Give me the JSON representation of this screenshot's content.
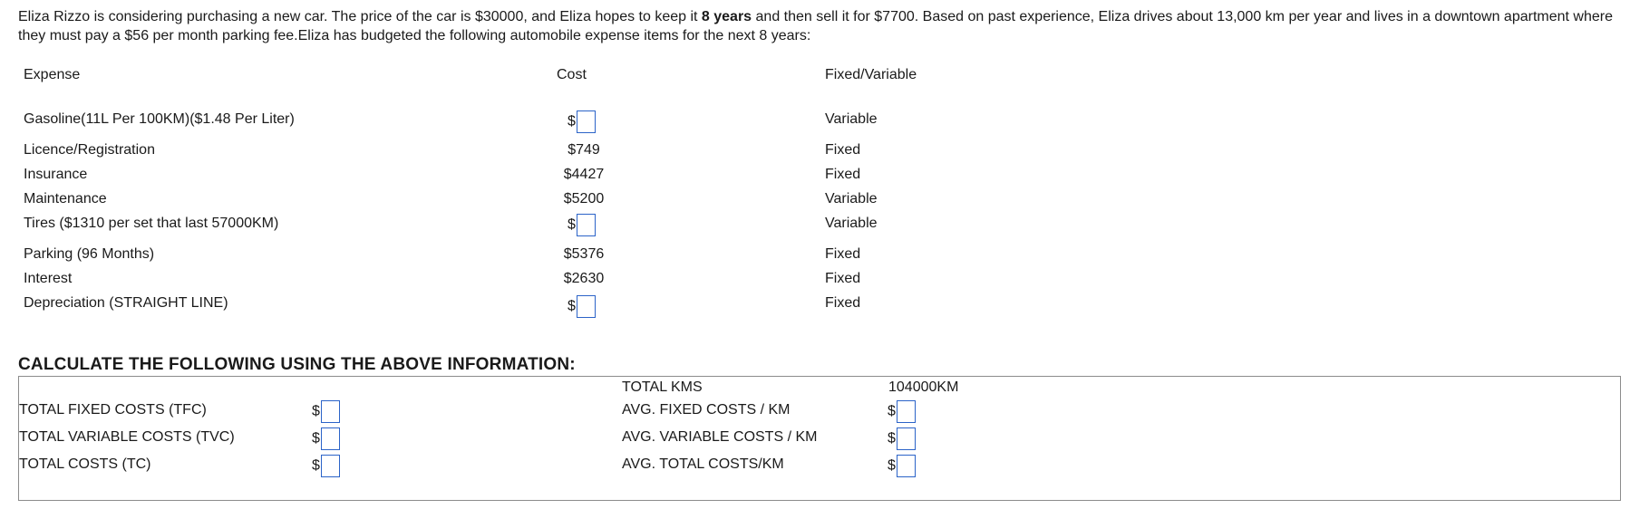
{
  "intro": {
    "part1": "Eliza Rizzo is considering purchasing a new car. The price of the car is $30000, and Eliza hopes to keep it ",
    "bold": "8 years",
    "part2": " and then sell it for $7700. Based on past experience, Eliza drives about 13,000 km per year and lives in a downtown apartment where they must pay a $56 per month parking fee.Eliza has budgeted the following automobile expense items for the next  8 years:"
  },
  "table": {
    "headers": {
      "expense": "Expense",
      "cost": "Cost",
      "type": "Fixed/Variable"
    },
    "rows": [
      {
        "expense": "Gasoline(11L Per 100KM)($1.48 Per Liter)",
        "cost": "$",
        "type": "Variable"
      },
      {
        "expense": "Licence/Registration",
        "cost": "$749",
        "type": "Fixed"
      },
      {
        "expense": "Insurance",
        "cost": "$4427",
        "type": "Fixed"
      },
      {
        "expense": "Maintenance",
        "cost": "$5200",
        "type": "Variable"
      },
      {
        "expense": "Tires ($1310 per set that last 57000KM)",
        "cost": "$",
        "type": "Variable"
      },
      {
        "expense": "Parking (96 Months)",
        "cost": "$5376",
        "type": "Fixed"
      },
      {
        "expense": "Interest",
        "cost": "$2630",
        "type": "Fixed"
      },
      {
        "expense": "Depreciation (STRAIGHT LINE)",
        "cost": "$",
        "type": "Fixed"
      }
    ]
  },
  "calc": {
    "title": "CALCULATE THE FOLLOWING USING THE ABOVE INFORMATION:",
    "total_kms_label": "TOTAL KMS",
    "total_kms_value": "104000KM",
    "tfc_label": "TOTAL FIXED COSTS (TFC)",
    "tvc_label": "TOTAL VARIABLE COSTS (TVC)",
    "tc_label": "TOTAL COSTS (TC)",
    "afc_label": "AVG. FIXED COSTS / KM",
    "avc_label": "AVG. VARIABLE COSTS / KM",
    "atc_label": "AVG. TOTAL COSTS/KM",
    "currency": "$"
  }
}
